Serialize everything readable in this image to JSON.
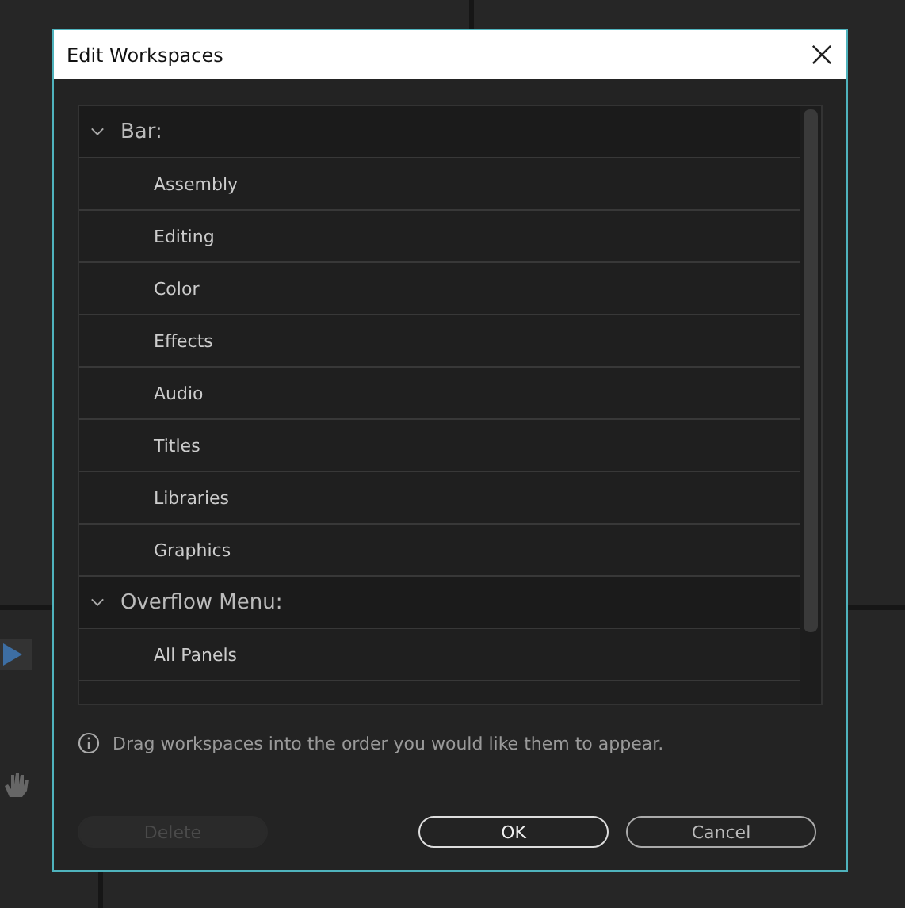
{
  "window": {
    "title": "Edit Workspaces"
  },
  "groups": [
    {
      "label": "Bar:",
      "expanded": true,
      "items": [
        "Assembly",
        "Editing",
        "Color",
        "Effects",
        "Audio",
        "Titles",
        "Libraries",
        "Graphics"
      ]
    },
    {
      "label": "Overflow Menu:",
      "expanded": true,
      "items": [
        "All Panels"
      ]
    }
  ],
  "hint": "Drag workspaces into the order you would like them to appear.",
  "buttons": [
    {
      "label": "Delete",
      "kind": "secondary",
      "disabled": true
    },
    {
      "label": "OK",
      "kind": "primary",
      "disabled": false
    },
    {
      "label": "Cancel",
      "kind": "secondary",
      "disabled": false
    }
  ]
}
